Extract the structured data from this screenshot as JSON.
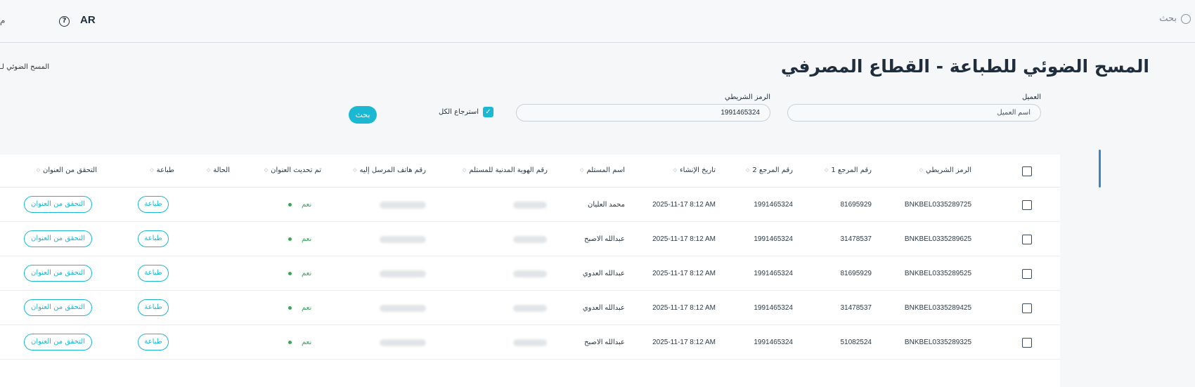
{
  "header": {
    "search_label": "بحث",
    "lang": "AR",
    "help": "?",
    "cut_text": "م"
  },
  "breadcrumb": "المسح الضوئي لـ",
  "page_title": "المسح الضوئي للطباعة - القطاع المصرفي",
  "filters": {
    "client_label": "العميل",
    "client_placeholder": "اسم العميل",
    "barcode_label": "الرمز الشريطي",
    "barcode_value": "1991465324",
    "return_all_label": "استرجاع الكل",
    "return_all_checked": true,
    "search_button": "بحث"
  },
  "table": {
    "columns": [
      "الرمز الشريطي",
      "رقم المرجع 1",
      "رقم المرجع 2",
      "تاريخ الإنشاء",
      "اسم المستلم",
      "رقم الهوية المدنية للمستلم",
      "رقم هاتف المرسل إليه",
      "تم تحديث العنوان",
      "الحالة",
      "طباعة",
      "التحقق من العنوان"
    ],
    "rows": [
      {
        "barcode": "BNKBEL0335289725",
        "ref1": "81695929",
        "ref2": "1991465324",
        "created": "2025-11-17 8:12 AM",
        "recipient": "محمد العليان",
        "address_updated": "نعم",
        "print": "طباعة",
        "verify": "التحقق من العنوان"
      },
      {
        "barcode": "BNKBEL0335289625",
        "ref1": "31478537",
        "ref2": "1991465324",
        "created": "2025-11-17 8:12 AM",
        "recipient": "عبدالله الاصبح",
        "address_updated": "نعم",
        "print": "طباعة",
        "verify": "التحقق من العنوان"
      },
      {
        "barcode": "BNKBEL0335289525",
        "ref1": "81695929",
        "ref2": "1991465324",
        "created": "2025-11-17 8:12 AM",
        "recipient": "عبدالله العدوي",
        "address_updated": "نعم",
        "print": "طباعة",
        "verify": "التحقق من العنوان"
      },
      {
        "barcode": "BNKBEL0335289425",
        "ref1": "31478537",
        "ref2": "1991465324",
        "created": "2025-11-17 8:12 AM",
        "recipient": "عبدالله العدوي",
        "address_updated": "نعم",
        "print": "طباعة",
        "verify": "التحقق من العنوان"
      },
      {
        "barcode": "BNKBEL0335289325",
        "ref1": "51082524",
        "ref2": "1991465324",
        "created": "2025-11-17 8:12 AM",
        "recipient": "عبدالله الاصبح",
        "address_updated": "نعم",
        "print": "طباعة",
        "verify": "التحقق من العنوان"
      }
    ]
  },
  "colors": {
    "accent": "#1ab8d3",
    "success": "#3aa65a",
    "text": "#1f2d3d"
  }
}
